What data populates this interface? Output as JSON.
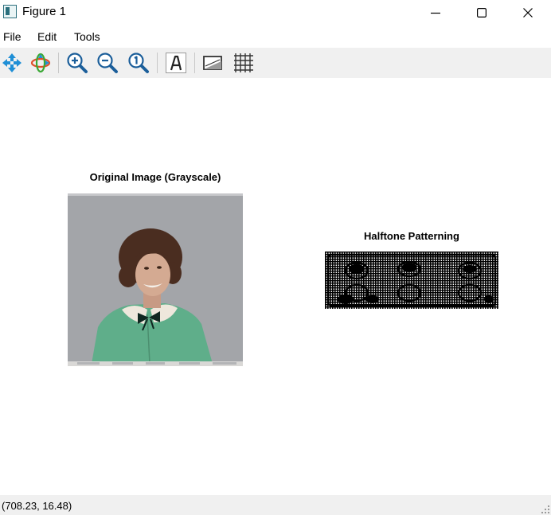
{
  "window": {
    "title": "Figure 1",
    "controls": [
      "minimize",
      "maximize",
      "close"
    ]
  },
  "menu": {
    "items": [
      {
        "label": "File"
      },
      {
        "label": "Edit"
      },
      {
        "label": "Tools"
      }
    ]
  },
  "toolbar": {
    "tools": [
      {
        "name": "pan-icon",
        "tooltip": "Pan"
      },
      {
        "name": "rotate-3d-icon",
        "tooltip": "Rotate"
      },
      {
        "name": "zoom-in-icon",
        "tooltip": "Zoom in"
      },
      {
        "name": "zoom-out-icon",
        "tooltip": "Zoom out"
      },
      {
        "name": "zoom-reset-icon",
        "tooltip": "Reset zoom"
      },
      {
        "name": "text-tool-icon",
        "tooltip": "Text"
      },
      {
        "name": "colorbar-icon",
        "tooltip": "Colorbar"
      },
      {
        "name": "grid-icon",
        "tooltip": "Grid"
      }
    ]
  },
  "figure": {
    "subplots": [
      {
        "title": "Original Image (Grayscale)",
        "content": "photo of a smiling woman in a green jacket"
      },
      {
        "title": "Halftone Patterning",
        "content": "black and white halftone dot pattern"
      }
    ]
  },
  "status": {
    "coordinates": "(708.23, 16.48)"
  },
  "colors": {
    "toolbar_bg": "#f0f0f0",
    "status_bg": "#f0f0f0",
    "photo_bg": "#a3a5a9",
    "jacket": "#5fae8a",
    "hair": "#4a2d20"
  }
}
